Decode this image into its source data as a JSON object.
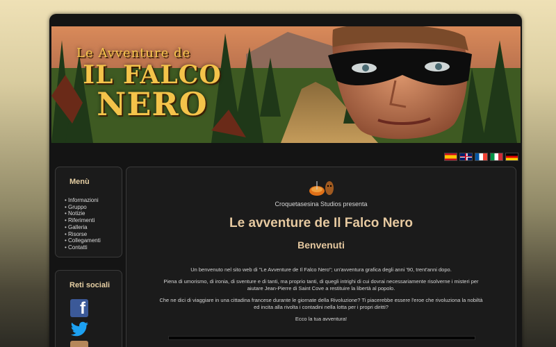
{
  "banner": {
    "title_line1": "Le Avventure de",
    "title_line2": "IL FALCO",
    "title_line3": "NERO"
  },
  "languages": [
    "es",
    "en",
    "fr",
    "it",
    "de"
  ],
  "menu": {
    "title": "Menù",
    "items": [
      "Informazioni",
      "Gruppo",
      "Notizie",
      "Riferimenti",
      "Galleria",
      "Risorse",
      "Collegamenti",
      "Contatti"
    ]
  },
  "social": {
    "title": "Reti sociali",
    "icons": [
      "facebook-icon",
      "twitter-icon",
      "instagram-icon"
    ]
  },
  "content": {
    "studio": "Croquetasesina Studios presenta",
    "heading": "Le avventure de Il Falco Nero",
    "welcome": "Benvenuti",
    "paragraphs": [
      "Un benvenuto nel sito web di \"Le Avventure de Il Falco Nero\"; un'avventura grafica degli anni '90, trent'anni dopo.",
      "Piena di umorismo, di ironia, di sventure e di tanti, ma proprio tanti, di quegli intrighi di cui dovrai necessariamente risolverne i misteri per aiutare Jean-Pierre di Saint Cove a restituire la libertà al popolo.",
      "Che ne dici di viaggiare in una cittadina francese durante le giornate della Rivoluzione? Ti piacerebbe essere l'eroe che rivoluziona la nobiltà ed incita alla rivolta i contadini nella lotta per i propri diritti?",
      "Ecco la tua avventura!"
    ]
  },
  "colors": {
    "accent": "#e6c9a0",
    "panel": "#1b1b1b",
    "title_gold": "#f4c34a"
  }
}
